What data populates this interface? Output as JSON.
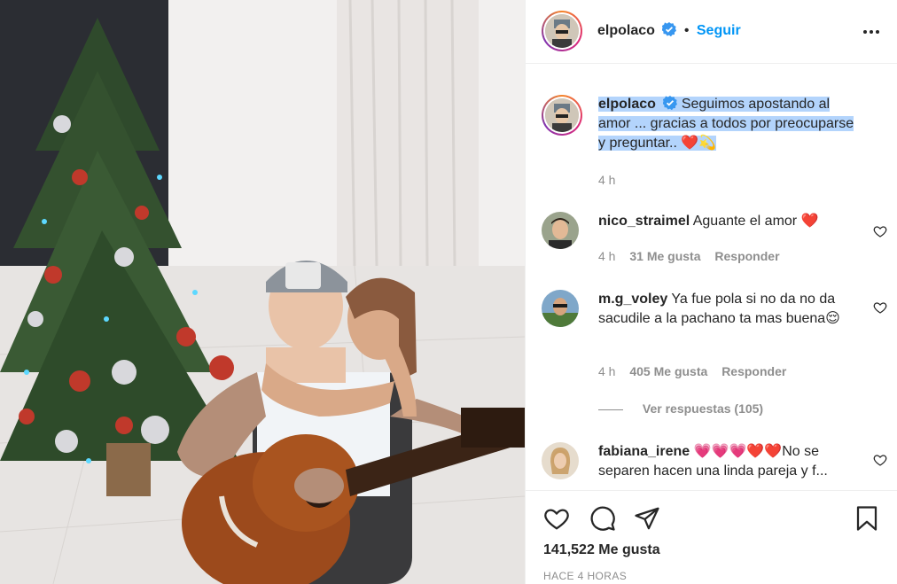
{
  "post": {
    "author": "elpolaco",
    "follow_label": "Seguir",
    "separator": "•",
    "caption": "Seguimos apostando al amor ... gracias a todos por preocuparse y preguntar.. ❤️💫",
    "caption_time": "4 h",
    "likes_label": "141,522 Me gusta",
    "posted_ago": "HACE 4 HORAS"
  },
  "comments": [
    {
      "user": "nico_straimel",
      "text": "Aguante el amor ❤️",
      "time": "4 h",
      "likes": "31 Me gusta",
      "reply": "Responder"
    },
    {
      "user": "m.g_voley",
      "text": "Ya fue pola si no da no da sacudile a la pachano ta mas buena😌",
      "time": "4 h",
      "likes": "405 Me gusta",
      "reply": "Responder",
      "view_replies": "Ver respuestas (105)"
    },
    {
      "user": "fabiana_irene",
      "text": "💗💗💗❤️❤️No se separen hacen una linda pareja y f..."
    }
  ],
  "icons": {
    "verified": "verified-badge-icon",
    "more": "more-options-icon",
    "like": "heart-icon",
    "comment": "comment-icon",
    "share": "share-icon",
    "save": "bookmark-icon"
  },
  "colors": {
    "accent": "#0095f6",
    "text": "#262626",
    "muted": "#8e8e8e",
    "selection": "#b3d4fc"
  }
}
